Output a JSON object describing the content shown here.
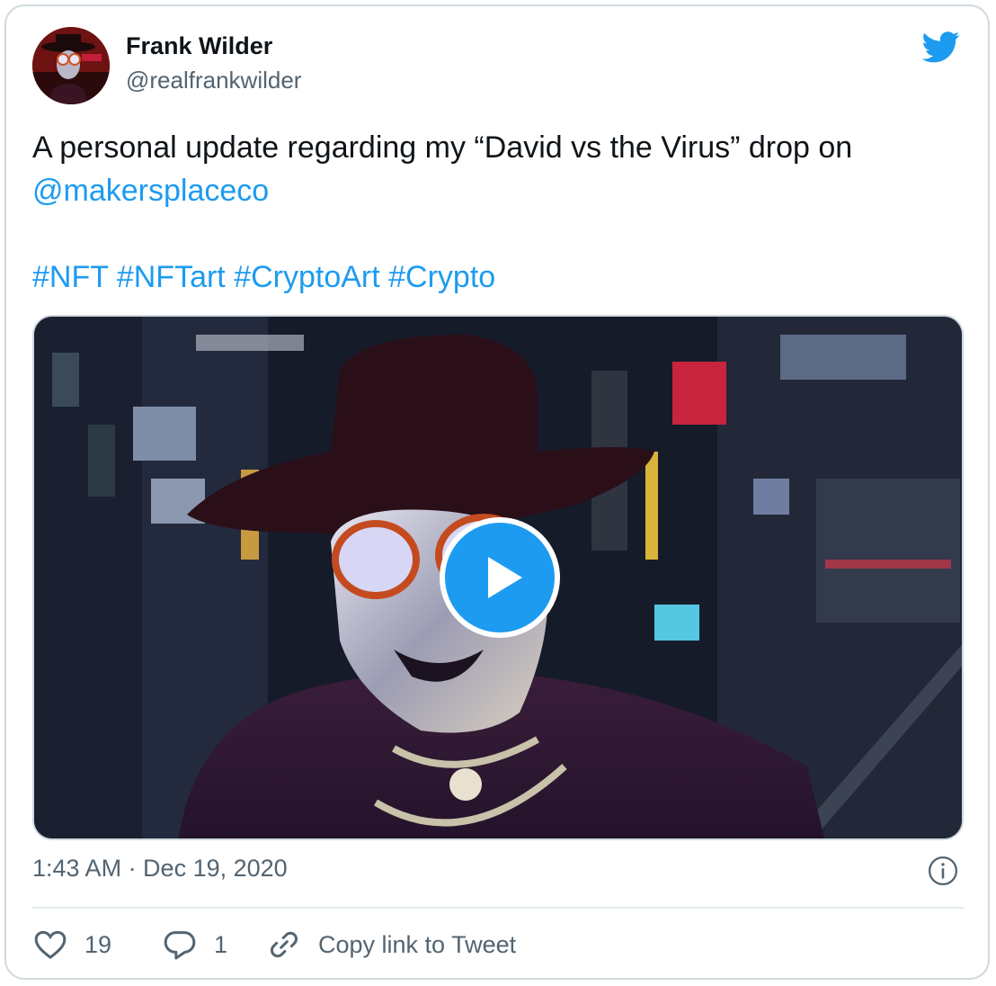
{
  "author": {
    "name": "Frank Wilder",
    "handle": "@realfrankwilder"
  },
  "tweet": {
    "line1": "A personal update regarding my “David vs the Virus” drop on",
    "mention": "@makersplaceco",
    "hashtags": "#NFT #NFTart #CryptoArt #Crypto"
  },
  "meta": {
    "timestamp": "1:43 AM · Dec 19, 2020"
  },
  "actions": {
    "likes": "19",
    "replies": "1",
    "copy_link": "Copy link to Tweet"
  },
  "colors": {
    "accent": "#1d9bf0",
    "secondary_text": "#536471",
    "border": "#cfd9de"
  },
  "icons": [
    "twitter-bird-icon",
    "play-icon",
    "info-icon",
    "heart-icon",
    "reply-icon",
    "link-icon"
  ]
}
